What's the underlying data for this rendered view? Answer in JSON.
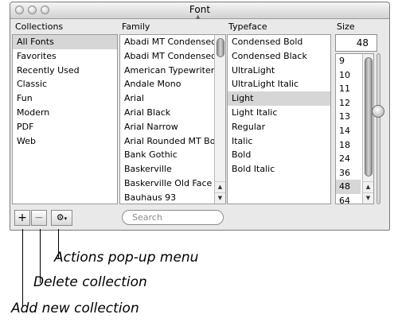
{
  "window": {
    "title": "Font"
  },
  "columns": {
    "collections": "Collections",
    "family": "Family",
    "typeface": "Typeface",
    "size": "Size"
  },
  "collections": [
    "All Fonts",
    "Favorites",
    "Recently Used",
    "Classic",
    "Fun",
    "Modern",
    "PDF",
    "Web"
  ],
  "selected_collection": "All Fonts",
  "families": [
    "Abadi MT Condensed",
    "Abadi MT Condensed",
    "American Typewriter",
    "Andale Mono",
    "Arial",
    "Arial Black",
    "Arial Narrow",
    "Arial Rounded MT Bol",
    "Bank Gothic",
    "Baskerville",
    "Baskerville Old Face",
    "Bauhaus 93"
  ],
  "typefaces": [
    "Condensed Bold",
    "Condensed Black",
    "UltraLight",
    "UltraLight Italic",
    "Light",
    "Light Italic",
    "Regular",
    "Italic",
    "Bold",
    "Bold Italic"
  ],
  "selected_typeface": "Light",
  "size": {
    "value": "48",
    "options": [
      "9",
      "10",
      "11",
      "12",
      "13",
      "14",
      "18",
      "24",
      "36",
      "48",
      "64"
    ],
    "selected": "48"
  },
  "toolbar": {
    "add_label": "+",
    "delete_label": "−",
    "actions_icon": "gear-icon",
    "search_placeholder": "Search"
  },
  "callouts": {
    "actions": "Actions pop-up menu",
    "delete": "Delete collection",
    "add": "Add new collection"
  }
}
